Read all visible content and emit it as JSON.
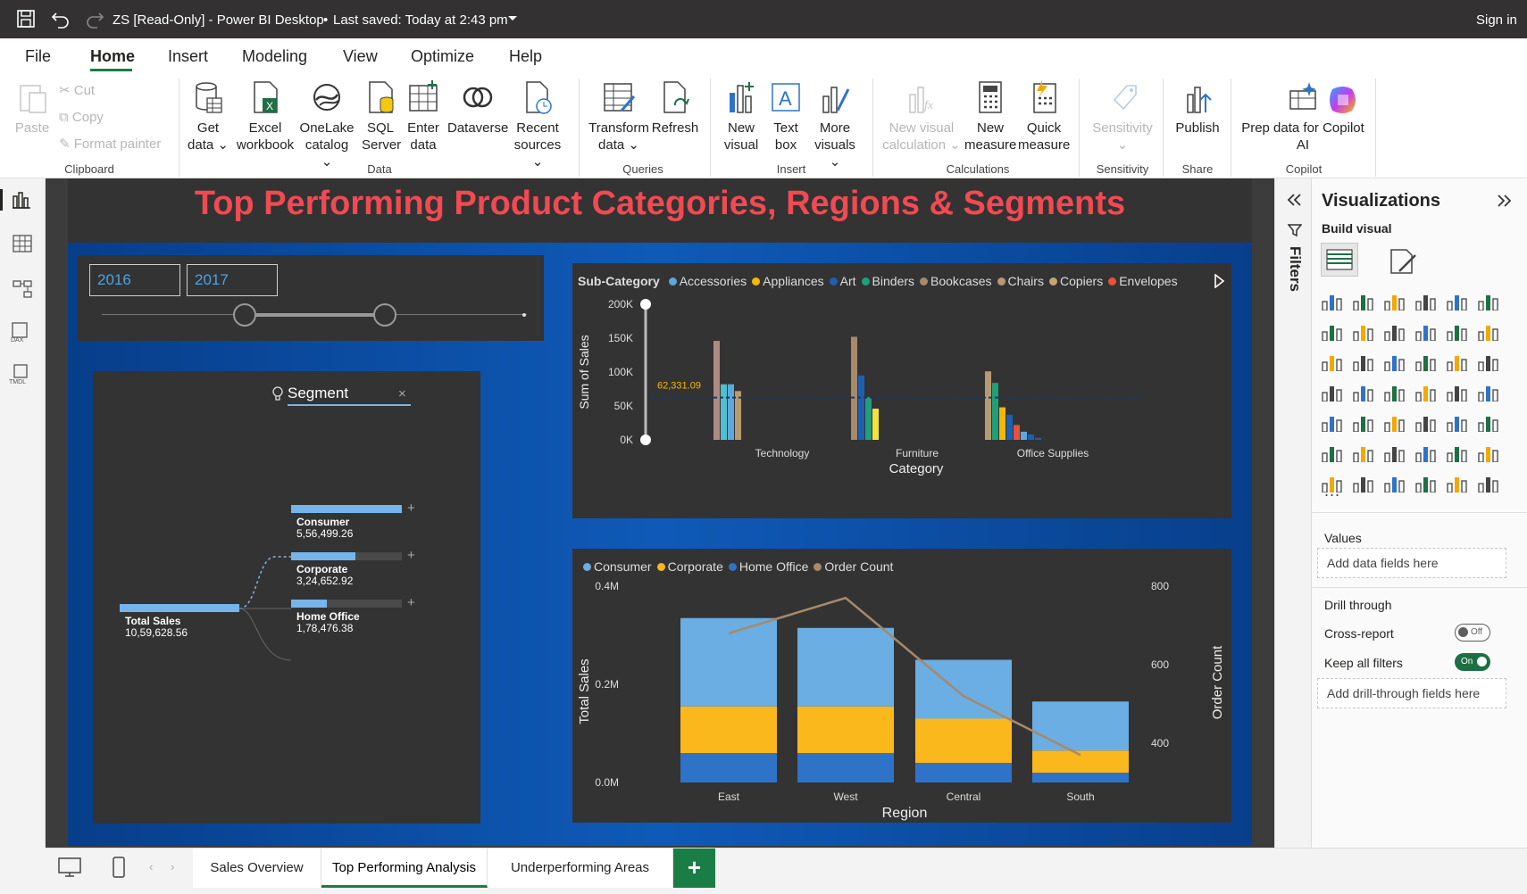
{
  "titlebar": {
    "title": "ZS [Read-Only] - Power BI Desktop",
    "saved": "Last saved: Today at 2:43 pm",
    "signin": "Sign in"
  },
  "menu": {
    "tabs": [
      "File",
      "Home",
      "Insert",
      "Modeling",
      "View",
      "Optimize",
      "Help"
    ]
  },
  "ribbon": {
    "clipboard": {
      "paste": "Paste",
      "cut": "Cut",
      "copy": "Copy",
      "format_painter": "Format painter",
      "group": "Clipboard"
    },
    "data": {
      "get_data": [
        "Get",
        "data"
      ],
      "excel": [
        "Excel",
        "workbook"
      ],
      "onelake": [
        "OneLake",
        "catalog"
      ],
      "sql": [
        "SQL",
        "Server"
      ],
      "enter": [
        "Enter",
        "data"
      ],
      "dataverse": "Dataverse",
      "recent": [
        "Recent",
        "sources"
      ],
      "group": "Data"
    },
    "queries": {
      "transform": [
        "Transform",
        "data"
      ],
      "refresh": "Refresh",
      "group": "Queries"
    },
    "insert": {
      "new_visual": [
        "New",
        "visual"
      ],
      "text_box": [
        "Text",
        "box"
      ],
      "more_visuals": [
        "More",
        "visuals"
      ],
      "group": "Insert"
    },
    "calculations": {
      "new_visual_calc": [
        "New visual",
        "calculation"
      ],
      "new_measure": [
        "New",
        "measure"
      ],
      "quick_measure": [
        "Quick",
        "measure"
      ],
      "group": "Calculations"
    },
    "sensitivity": {
      "label": "Sensitivity",
      "group": "Sensitivity"
    },
    "share": {
      "publish": "Publish",
      "group": "Share"
    },
    "copilot": {
      "prep": [
        "Prep data for Copilot",
        "AI"
      ],
      "group": "Copilot"
    }
  },
  "report": {
    "title": "Top Performing Product Categories, Regions & Segments",
    "slicer": {
      "start": "2016",
      "end": "2017"
    },
    "decomp": {
      "field": "Segment",
      "root": {
        "label": "Total Sales",
        "value": "10,59,628.56"
      },
      "children": [
        {
          "label": "Consumer",
          "value": "5,56,499.26",
          "fraction": 1.0
        },
        {
          "label": "Corporate",
          "value": "3,24,652.92",
          "fraction": 0.58
        },
        {
          "label": "Home Office",
          "value": "1,78,476.38",
          "fraction": 0.32
        }
      ]
    }
  },
  "chart_data": [
    {
      "type": "bar",
      "legend_title": "Sub-Category",
      "legend": [
        {
          "name": "Accessories",
          "color": "#5fa8dc"
        },
        {
          "name": "Appliances",
          "color": "#f5b800"
        },
        {
          "name": "Art",
          "color": "#1f5fb0"
        },
        {
          "name": "Binders",
          "color": "#1fa07a"
        },
        {
          "name": "Bookcases",
          "color": "#a8896a"
        },
        {
          "name": "Chairs",
          "color": "#b89a72"
        },
        {
          "name": "Copiers",
          "color": "#c2a66e"
        },
        {
          "name": "Envelopes",
          "color": "#e8513a"
        }
      ],
      "categories": [
        "Technology",
        "Furniture",
        "Office Supplies"
      ],
      "bars": [
        {
          "category": "Technology",
          "values": [
            {
              "v": 146000,
              "c": "#b08a82"
            },
            {
              "v": 82000,
              "c": "#4ec0d0"
            },
            {
              "v": 82000,
              "c": "#5fa8dc"
            },
            {
              "v": 72000,
              "c": "#b89a72"
            }
          ]
        },
        {
          "category": "Furniture",
          "values": [
            {
              "v": 152000,
              "c": "#a8896a"
            },
            {
              "v": 95000,
              "c": "#1f5fb0"
            },
            {
              "v": 63000,
              "c": "#1fa07a"
            },
            {
              "v": 46000,
              "c": "#f5e23a"
            }
          ]
        },
        {
          "category": "Office Supplies",
          "values": [
            {
              "v": 101000,
              "c": "#b89a72"
            },
            {
              "v": 84000,
              "c": "#1fa07a"
            },
            {
              "v": 48000,
              "c": "#f5b800"
            },
            {
              "v": 37000,
              "c": "#1f5fb0"
            },
            {
              "v": 22000,
              "c": "#e8513a"
            },
            {
              "v": 12000,
              "c": "#5fa8dc"
            },
            {
              "v": 8000,
              "c": "#1f5fb0"
            },
            {
              "v": 3000,
              "c": "#1f5fb0"
            }
          ]
        }
      ],
      "average": {
        "value": 62331.09,
        "label": "62,331.09"
      },
      "ylabel": "Sum of Sales",
      "xlabel": "Category",
      "yticks": [
        "0K",
        "50K",
        "100K",
        "150K",
        "200K"
      ],
      "ylim": [
        0,
        200000
      ]
    },
    {
      "type": "bar",
      "legend": [
        {
          "name": "Consumer",
          "color": "#6aaee3"
        },
        {
          "name": "Corporate",
          "color": "#fbb81c"
        },
        {
          "name": "Home Office",
          "color": "#2f73c8"
        },
        {
          "name": "Order Count",
          "color": "#a8896a"
        }
      ],
      "categories": [
        "East",
        "West",
        "Central",
        "South"
      ],
      "series": [
        {
          "name": "Home Office",
          "values": [
            0.06,
            0.06,
            0.04,
            0.02
          ],
          "color": "#2f73c8"
        },
        {
          "name": "Corporate",
          "values": [
            0.095,
            0.095,
            0.09,
            0.045
          ],
          "color": "#fbb81c"
        },
        {
          "name": "Consumer",
          "values": [
            0.18,
            0.16,
            0.12,
            0.1
          ],
          "color": "#6aaee3"
        }
      ],
      "line": {
        "name": "Order Count",
        "values": [
          680,
          770,
          520,
          370
        ],
        "color": "#a8896a"
      },
      "ylabel": "Total Sales",
      "y2label": "Order Count",
      "xlabel": "Region",
      "yticks": [
        "0.0M",
        "0.2M",
        "0.4M"
      ],
      "ylim": [
        0,
        0.4
      ],
      "y2ticks": [
        "400",
        "600",
        "800"
      ],
      "y2lim": [
        300,
        800
      ]
    }
  ],
  "filters": {
    "label": "Filters"
  },
  "viz": {
    "title": "Visualizations",
    "build": "Build visual",
    "values": "Values",
    "add_fields": "Add data fields here",
    "drill": "Drill through",
    "cross": "Cross-report",
    "cross_state": "Off",
    "keep": "Keep all filters",
    "keep_state": "On",
    "add_drill": "Add drill-through fields here",
    "more": "..."
  },
  "pages": {
    "tabs": [
      "Sales Overview",
      "Top Performing Analysis",
      "Underperforming Areas"
    ],
    "add": "+"
  }
}
